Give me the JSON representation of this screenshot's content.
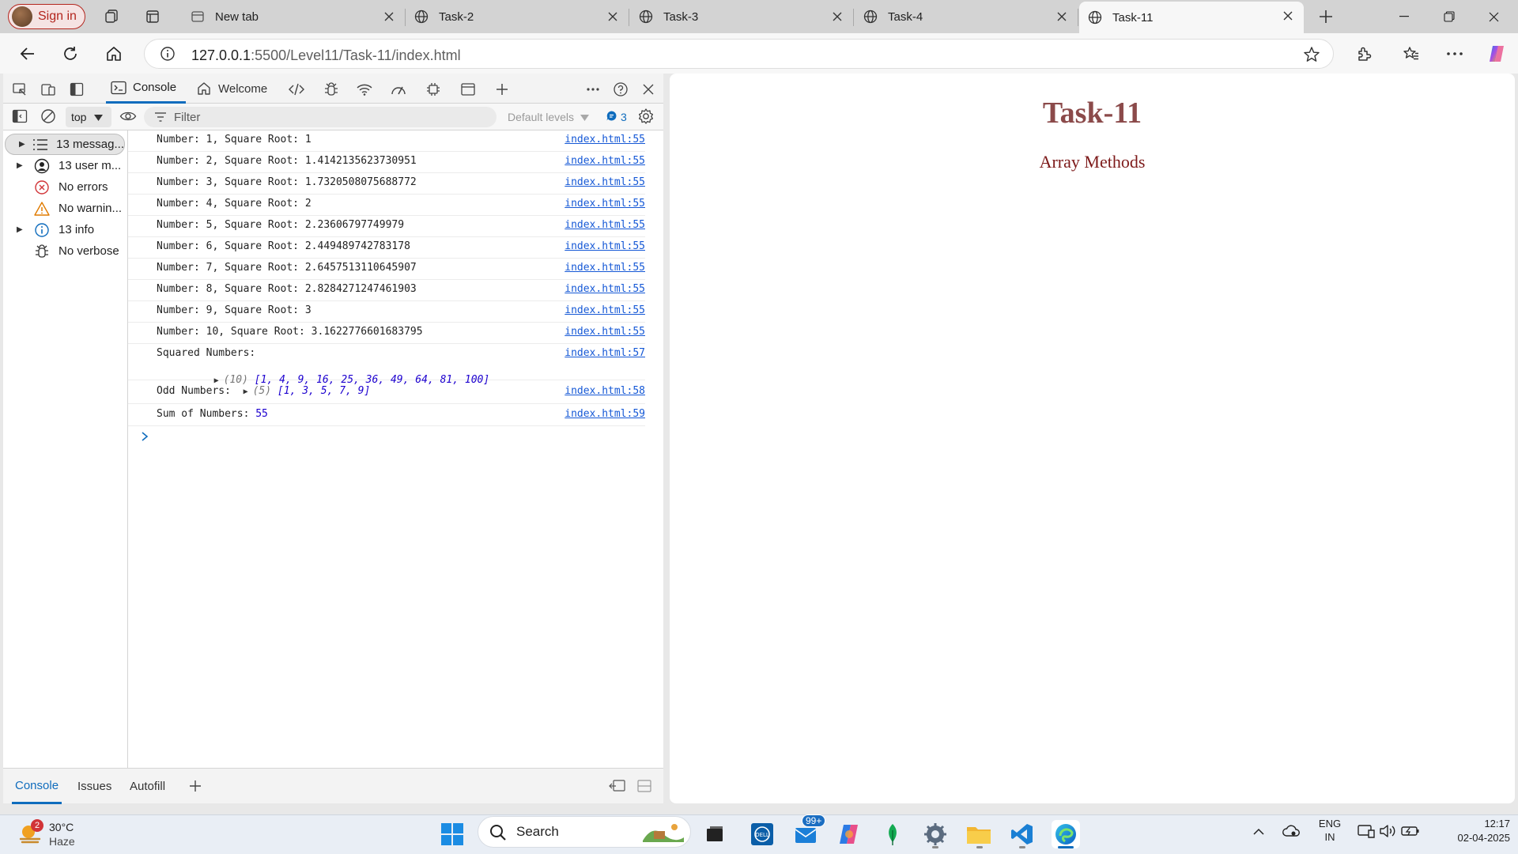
{
  "browser": {
    "signin_label": "Sign in",
    "tabs": [
      {
        "title": "New tab"
      },
      {
        "title": "Task-2"
      },
      {
        "title": "Task-3"
      },
      {
        "title": "Task-4"
      },
      {
        "title": "Task-11"
      }
    ],
    "url_host": "127.0.0.1",
    "url_rest": ":5500/Level11/Task-11/index.html"
  },
  "devtools": {
    "tabs": {
      "console": "Console",
      "welcome": "Welcome"
    },
    "context": "top",
    "filter_placeholder": "Filter",
    "levels": "Default levels",
    "issues_count": "3",
    "sidebar": [
      {
        "label": "13 messag...",
        "icon": "list-icon"
      },
      {
        "label": "13 user m...",
        "icon": "user-icon"
      },
      {
        "label": "No errors",
        "icon": "error-icon"
      },
      {
        "label": "No warnin...",
        "icon": "warning-icon"
      },
      {
        "label": "13 info",
        "icon": "info-icon"
      },
      {
        "label": "No verbose",
        "icon": "bug-icon"
      }
    ],
    "logs": [
      {
        "msg": "Number: 1, Square Root: 1",
        "src": "index.html:55"
      },
      {
        "msg": "Number: 2, Square Root: 1.4142135623730951",
        "src": "index.html:55"
      },
      {
        "msg": "Number: 3, Square Root: 1.7320508075688772",
        "src": "index.html:55"
      },
      {
        "msg": "Number: 4, Square Root: 2",
        "src": "index.html:55"
      },
      {
        "msg": "Number: 5, Square Root: 2.23606797749979",
        "src": "index.html:55"
      },
      {
        "msg": "Number: 6, Square Root: 2.449489742783178",
        "src": "index.html:55"
      },
      {
        "msg": "Number: 7, Square Root: 2.6457513110645907",
        "src": "index.html:55"
      },
      {
        "msg": "Number: 8, Square Root: 2.8284271247461903",
        "src": "index.html:55"
      },
      {
        "msg": "Number: 9, Square Root: 3",
        "src": "index.html:55"
      },
      {
        "msg": "Number: 10, Square Root: 3.1622776601683795",
        "src": "index.html:55"
      }
    ],
    "squared": {
      "label": "Squared Numbers:",
      "len": "(10)",
      "values": "[1, 4, 9, 16, 25, 36, 49, 64, 81, 100]",
      "src": "index.html:57"
    },
    "odd": {
      "label": "Odd Numbers:",
      "len": "(5)",
      "values": "[1, 3, 5, 7, 9]",
      "src": "index.html:58"
    },
    "sum": {
      "label": "Sum of Numbers:",
      "value": "55",
      "src": "index.html:59"
    },
    "drawer_tabs": {
      "console": "Console",
      "issues": "Issues",
      "autofill": "Autofill"
    }
  },
  "page": {
    "heading": "Task-11",
    "subheading": "Array Methods"
  },
  "taskbar": {
    "weather_temp": "30°C",
    "weather_desc": "Haze",
    "weather_badge": "2",
    "search_label": "Search",
    "mail_badge": "99+",
    "lang": "ENG",
    "region": "IN",
    "time": "12:17",
    "date": "02-04-2025"
  }
}
